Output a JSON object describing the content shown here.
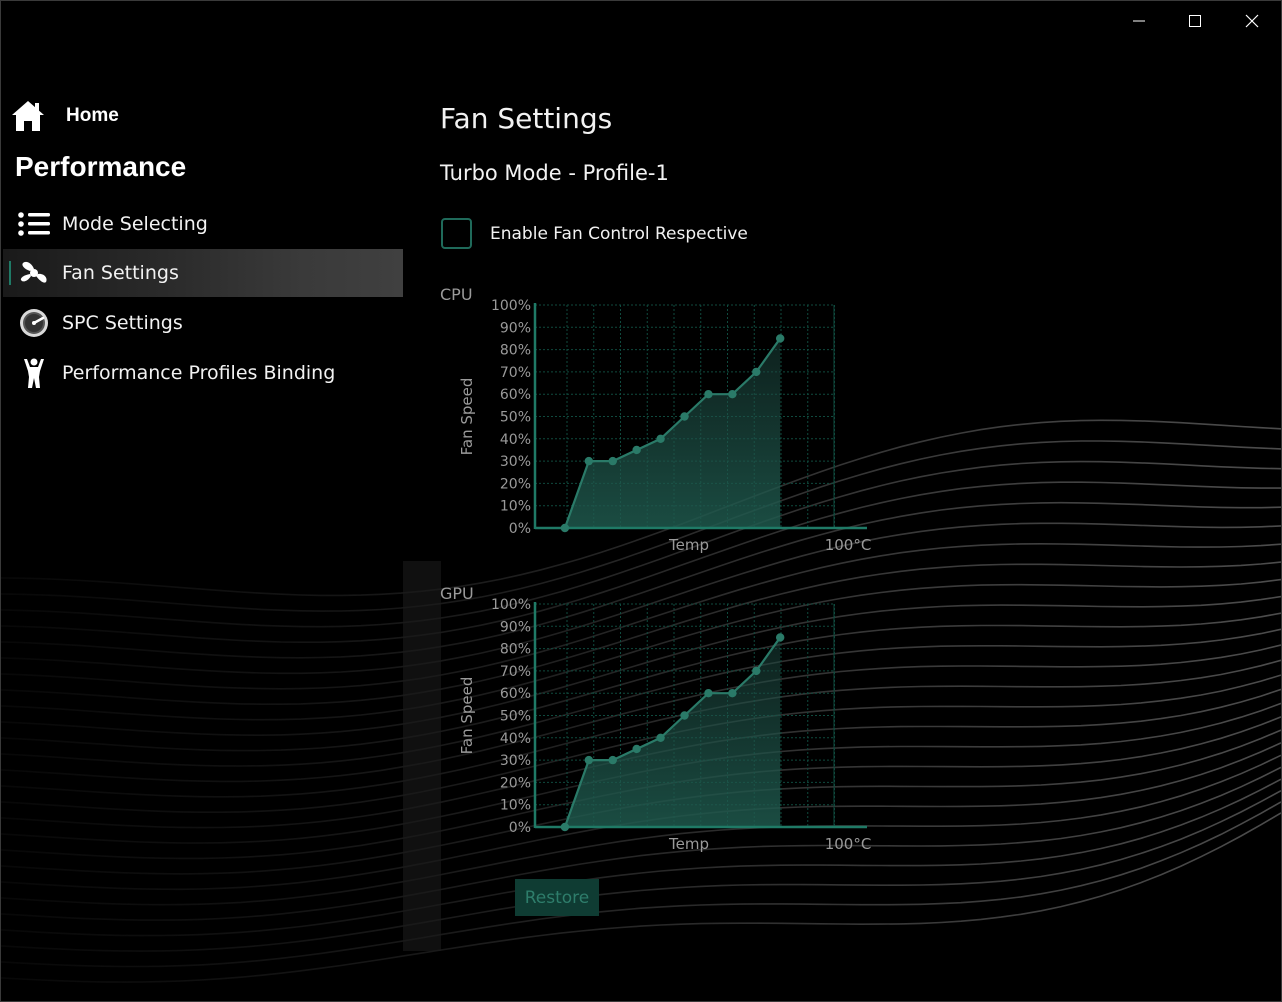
{
  "window": {
    "controls": [
      "minimize",
      "maximize",
      "close"
    ]
  },
  "sidebar": {
    "home_label": "Home",
    "section_title": "Performance",
    "items": [
      {
        "label": "Mode Selecting",
        "icon": "list-icon",
        "active": false
      },
      {
        "label": "Fan Settings",
        "icon": "fan-icon",
        "active": true
      },
      {
        "label": "SPC Settings",
        "icon": "speedometer-icon",
        "active": false
      },
      {
        "label": "Performance Profiles Binding",
        "icon": "person-icon",
        "active": false
      }
    ]
  },
  "main": {
    "title": "Fan Settings",
    "subtitle": "Turbo Mode - Profile-1",
    "checkbox_label": "Enable Fan Control Respective",
    "checkbox_checked": false,
    "restore_label": "Restore"
  },
  "colors": {
    "accent": "#1f7a66",
    "curve": "#2a7a68",
    "grid": "#0f4a3e",
    "axis": "#1f7a66",
    "button_bg": "#0f3c33",
    "button_text": "#2e7d6b"
  },
  "chart_data": [
    {
      "type": "line",
      "title": "CPU",
      "ylabel": "Fan Speed",
      "xlabel": "Temp",
      "x_end_label": "100°C",
      "y_ticks": [
        "100%",
        "90%",
        "80%",
        "70%",
        "60%",
        "50%",
        "40%",
        "30%",
        "20%",
        "10%",
        "0%"
      ],
      "ylim": [
        0,
        100
      ],
      "xlim": [
        0,
        100
      ],
      "grid": true,
      "fill": true,
      "x": [
        10,
        18,
        26,
        34,
        42,
        50,
        58,
        66,
        74,
        82
      ],
      "y": [
        0,
        30,
        30,
        35,
        40,
        50,
        60,
        60,
        70,
        85
      ]
    },
    {
      "type": "line",
      "title": "GPU",
      "ylabel": "Fan Speed",
      "xlabel": "Temp",
      "x_end_label": "100°C",
      "y_ticks": [
        "100%",
        "90%",
        "80%",
        "70%",
        "60%",
        "50%",
        "40%",
        "30%",
        "20%",
        "10%",
        "0%"
      ],
      "ylim": [
        0,
        100
      ],
      "xlim": [
        0,
        100
      ],
      "grid": true,
      "fill": true,
      "x": [
        10,
        18,
        26,
        34,
        42,
        50,
        58,
        66,
        74,
        82
      ],
      "y": [
        0,
        30,
        30,
        35,
        40,
        50,
        60,
        60,
        70,
        85
      ]
    }
  ]
}
